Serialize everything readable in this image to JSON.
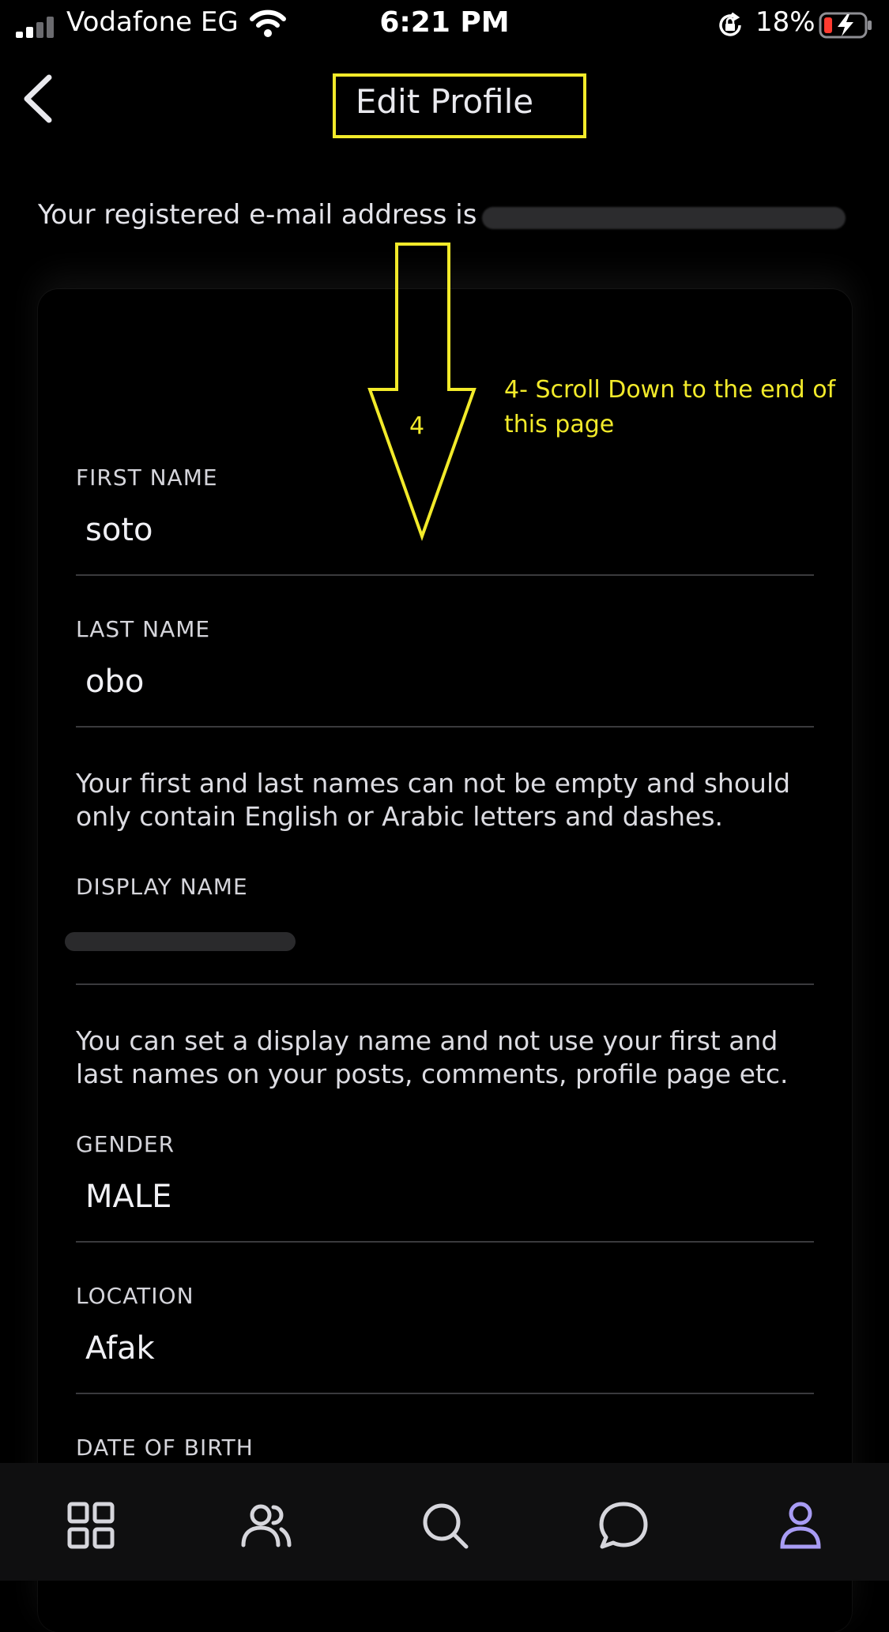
{
  "status_bar": {
    "carrier": "Vodafone EG",
    "time": "6:21 PM",
    "battery": "18%"
  },
  "header": {
    "title": "Edit Profile"
  },
  "email_notice": "Your registered e-mail address is",
  "fields": {
    "first_name": {
      "label": "FIRST NAME",
      "value": "soto"
    },
    "last_name": {
      "label": "LAST NAME",
      "value": "obo"
    },
    "names_helper": "Your first and last names can not be empty and should only contain English or Arabic letters and dashes.",
    "display_name": {
      "label": "DISPLAY NAME"
    },
    "display_helper": "You can set a display name and not use your first and last names on your posts, comments, profile page etc.",
    "gender": {
      "label": "GENDER",
      "value": "MALE"
    },
    "location": {
      "label": "LOCATION",
      "value": "Afak"
    },
    "date_of_birth": {
      "label": "DATE OF BIRTH"
    }
  },
  "annotation": {
    "number": "4",
    "text": "4- Scroll Down to the end of this page",
    "color": "#f2ea2a"
  },
  "tab_bar": {
    "items": [
      "grid-icon",
      "people-icon",
      "search-icon",
      "chat-icon",
      "profile-icon"
    ],
    "active_color": "#a89cf4"
  }
}
